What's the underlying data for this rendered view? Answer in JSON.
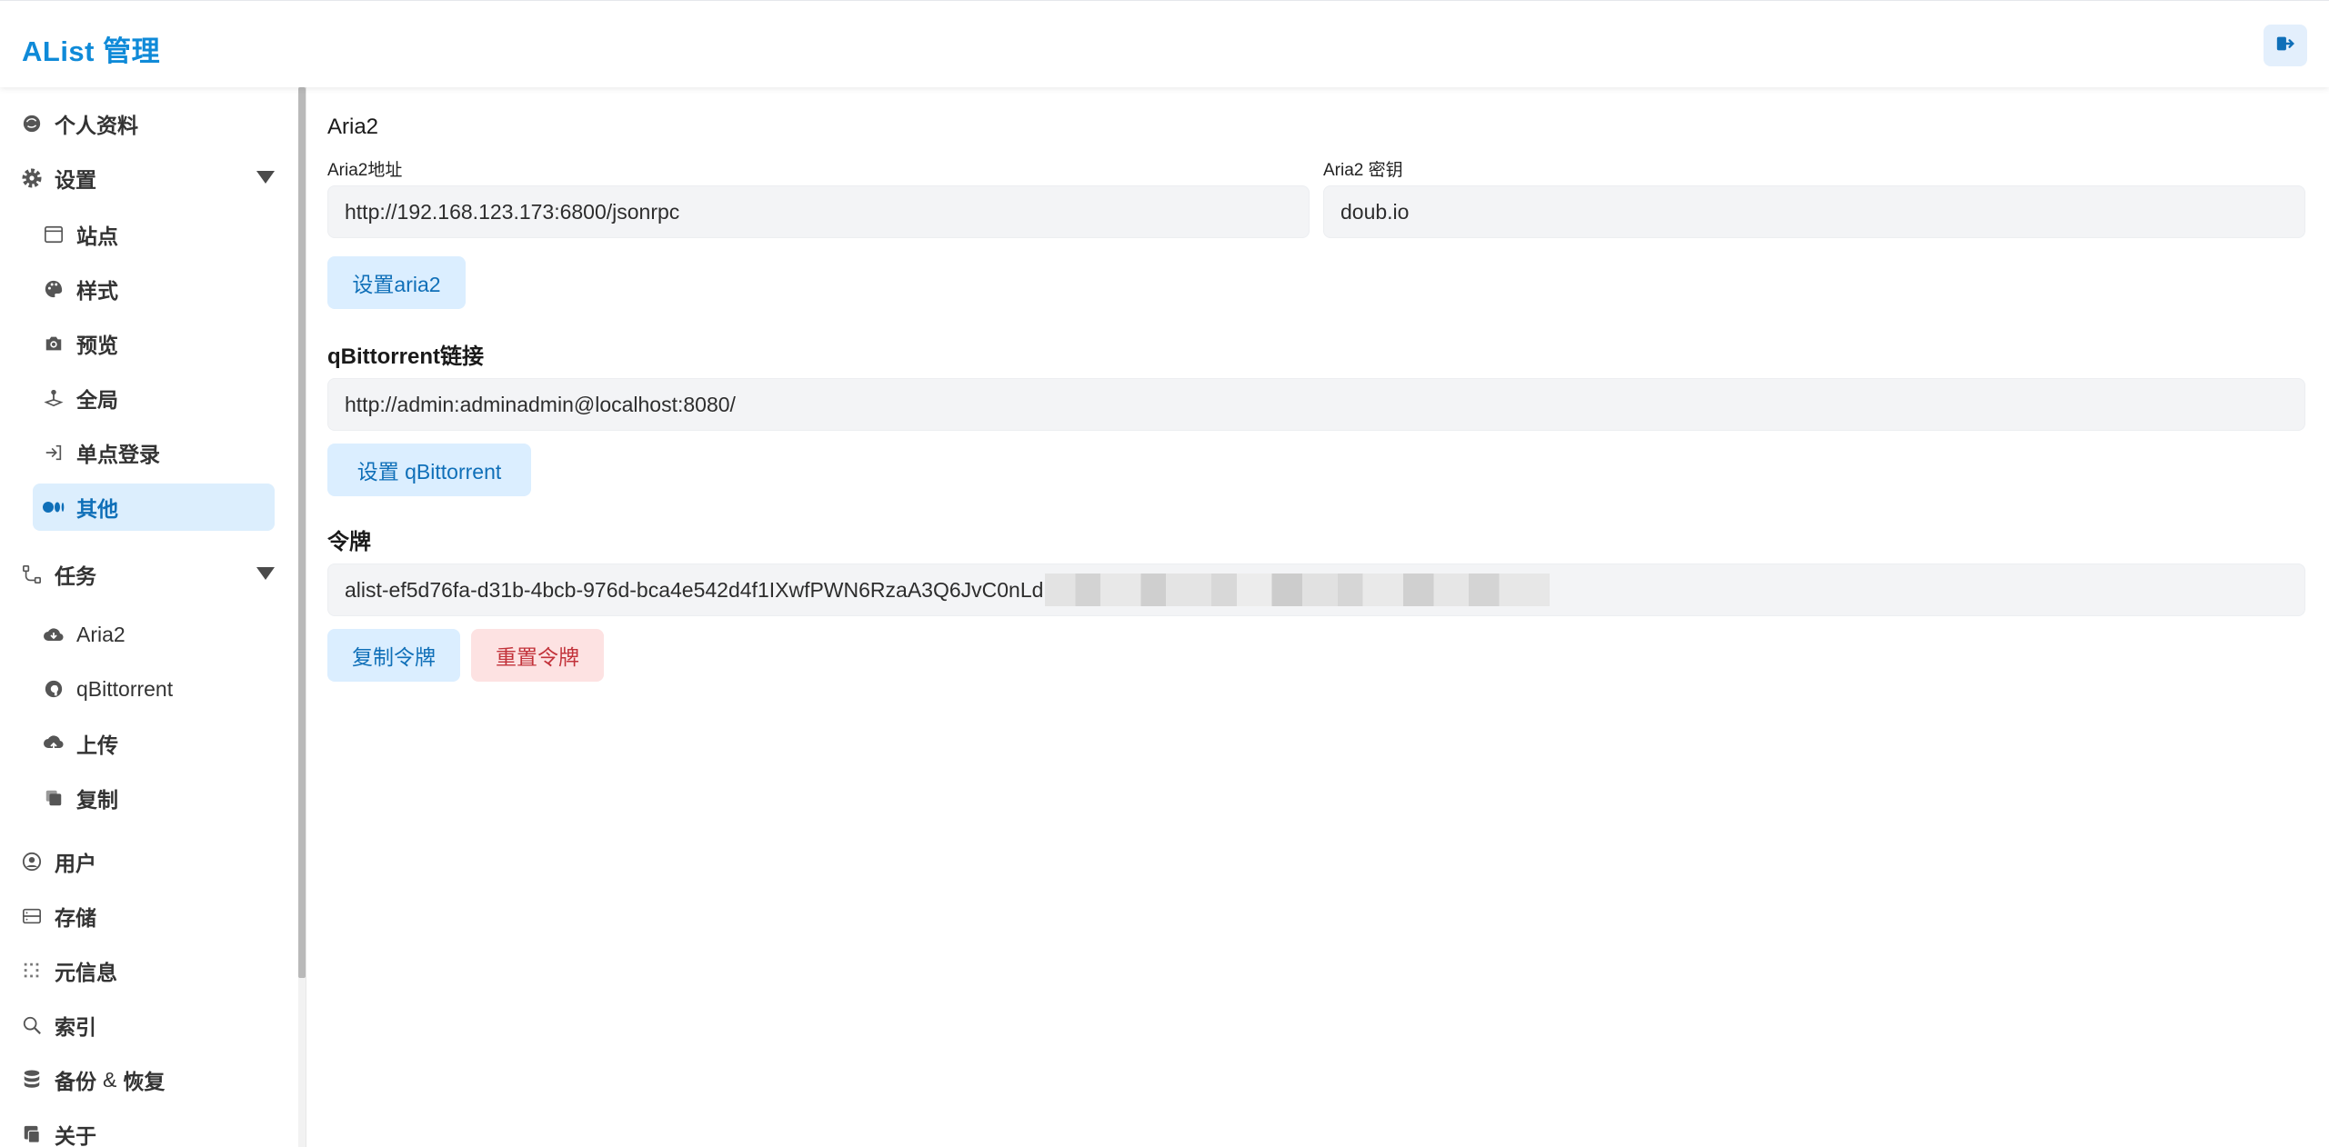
{
  "header": {
    "brand": "AList 管理",
    "logout_icon": "logout-icon"
  },
  "sidebar": {
    "profile": {
      "label": "个人资料",
      "icon": "profile-icon"
    },
    "settings": {
      "label": "设置",
      "icon": "gear-icon",
      "items": [
        {
          "label": "站点",
          "icon": "window-icon"
        },
        {
          "label": "样式",
          "icon": "palette-icon"
        },
        {
          "label": "预览",
          "icon": "camera-icon"
        },
        {
          "label": "全局",
          "icon": "joystick-icon"
        },
        {
          "label": "单点登录",
          "icon": "sign-in-icon"
        },
        {
          "label": "其他",
          "icon": "medium-icon"
        }
      ]
    },
    "tasks": {
      "label": "任务",
      "icon": "workflow-icon",
      "items": [
        {
          "label": "Aria2",
          "icon": "cloud-download-icon"
        },
        {
          "label": "qBittorrent",
          "icon": "qbittorrent-icon"
        },
        {
          "label": "上传",
          "icon": "cloud-upload-icon"
        },
        {
          "label": "复制",
          "icon": "copy-icon"
        }
      ]
    },
    "users": {
      "label": "用户",
      "icon": "user-circle-icon"
    },
    "storage": {
      "label": "存储",
      "icon": "storage-icon"
    },
    "meta": {
      "label": "元信息",
      "icon": "meta-icon"
    },
    "index": {
      "label": "索引",
      "icon": "search-icon"
    },
    "backup_a": "备份",
    "backup_amp": "&",
    "backup_b": "恢复",
    "backup_icon": "database-icon",
    "about": {
      "label": "关于",
      "icon": "about-icon"
    }
  },
  "main": {
    "aria2": {
      "title": "Aria2",
      "address_label": "Aria2地址",
      "address_value": "http://192.168.123.173:6800/jsonrpc",
      "secret_label": "Aria2 密钥",
      "secret_value": "doub.io",
      "button": "设置aria2"
    },
    "qbittorrent": {
      "title": "qBittorrent链接",
      "value": "http://admin:adminadmin@localhost:8080/",
      "button": "设置 qBittorrent"
    },
    "token": {
      "title": "令牌",
      "value_visible": "alist-ef5d76fa-d31b-4bcb-976d-bca4e542d4f1IXwfPWN6RzaA3Q6JvC0nLd",
      "copy_button": "复制令牌",
      "reset_button": "重置令牌"
    }
  },
  "colors": {
    "brand": "#0f8ad8",
    "active_bg": "#dceefd",
    "primary_text": "#0f6fb8",
    "danger_bg": "#fde2e2",
    "danger_text": "#c2323a",
    "input_bg": "#f3f4f6"
  }
}
